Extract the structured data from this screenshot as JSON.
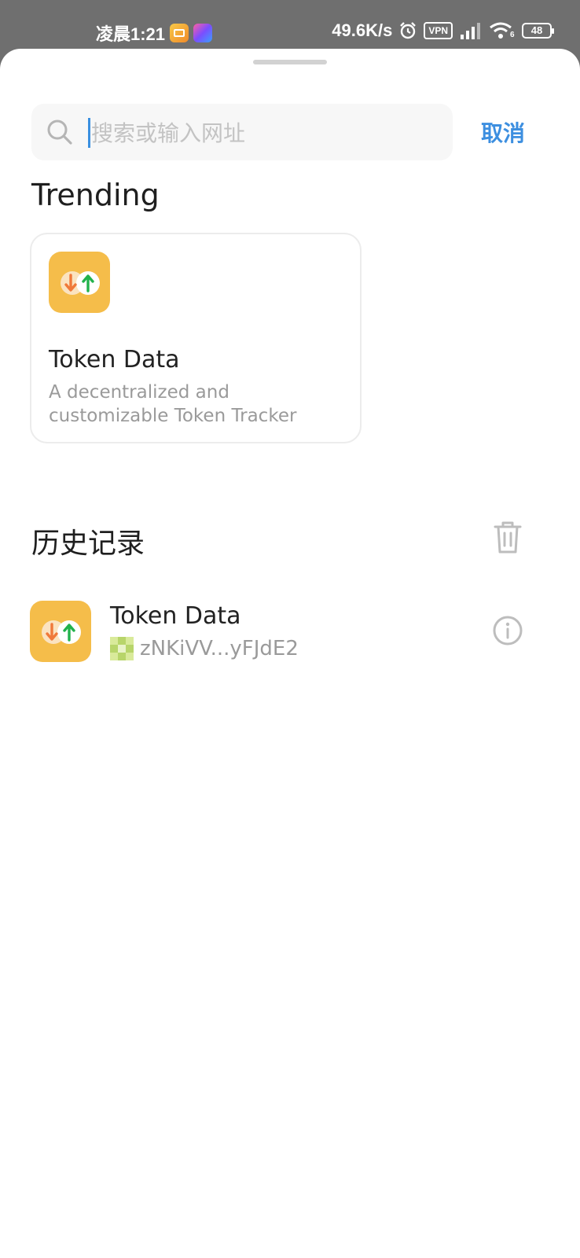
{
  "status_bar": {
    "time": "凌晨1:21",
    "network_speed": "49.6K/s",
    "vpn_label": "VPN",
    "battery": "48",
    "wifi_sub": "6"
  },
  "search": {
    "placeholder": "搜索或输入网址",
    "value": "",
    "cancel_label": "取消"
  },
  "trending": {
    "title": "Trending",
    "items": [
      {
        "name": "Token Data",
        "description": "A decentralized and customizable Token Tracker",
        "icon": "token-data-icon"
      }
    ]
  },
  "history": {
    "title": "历史记录",
    "clear_icon": "trash-icon",
    "items": [
      {
        "name": "Token Data",
        "address": "zNKiVV...yFJdE2",
        "icon": "token-data-icon",
        "action_icon": "info-icon"
      }
    ]
  },
  "colors": {
    "accent": "#3d8fe0",
    "app_icon_bg": "#f5bd4a",
    "arrow_down": "#f0793a",
    "arrow_up": "#22b24c"
  }
}
